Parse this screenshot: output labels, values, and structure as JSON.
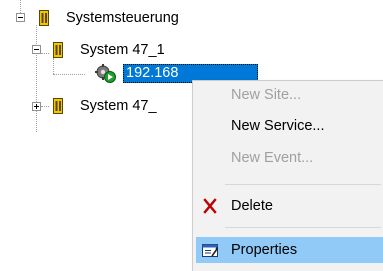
{
  "tree": {
    "root": {
      "label": "Systemsteuerung",
      "expanded": true
    },
    "children": [
      {
        "label": "System 47_1",
        "expanded": true,
        "children": [
          {
            "label": "192.168",
            "selected": true,
            "icon": "service-gear-icon"
          }
        ]
      },
      {
        "label": "System 47_",
        "expanded": false
      }
    ]
  },
  "context_menu": {
    "items": [
      {
        "label": "New Site...",
        "enabled": false
      },
      {
        "label": "New Service...",
        "enabled": true
      },
      {
        "label": "New Event...",
        "enabled": false
      },
      {
        "label": "Delete",
        "enabled": true,
        "icon": "delete-x-icon"
      },
      {
        "label": "Properties",
        "enabled": true,
        "icon": "properties-icon",
        "highlighted": true
      }
    ]
  },
  "colors": {
    "selection": "#0078d7",
    "menu_highlight": "#91c9f7",
    "menu_background": "#f2f2f2",
    "delete_icon": "#c00000",
    "device_icon": "#f5c400"
  }
}
